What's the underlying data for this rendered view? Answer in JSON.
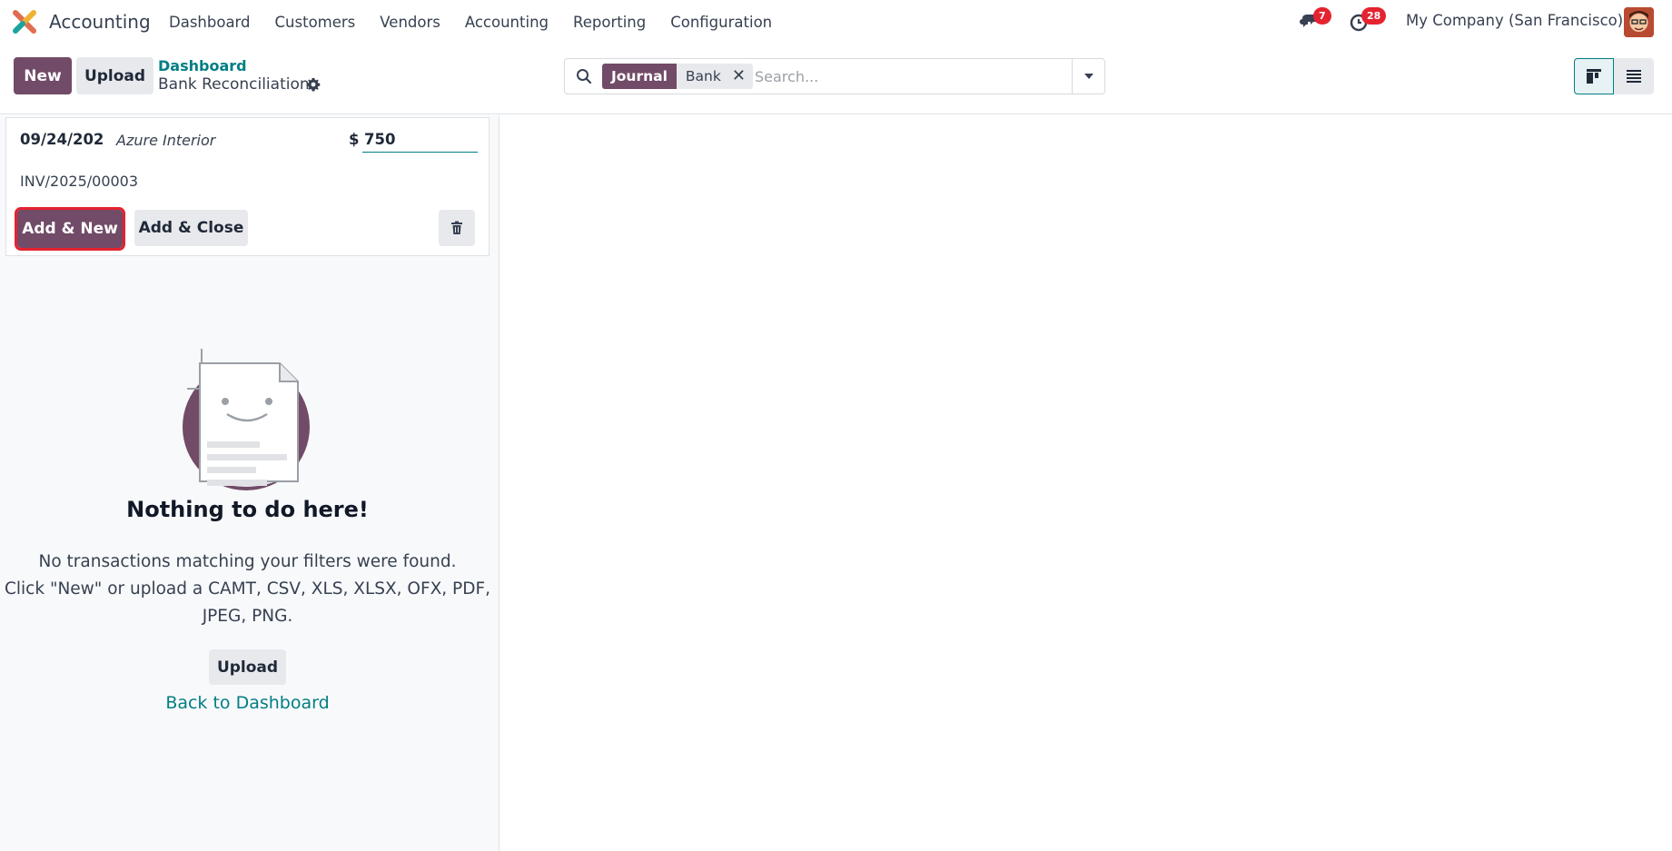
{
  "topbar": {
    "app_name": "Accounting",
    "menu": [
      "Dashboard",
      "Customers",
      "Vendors",
      "Accounting",
      "Reporting",
      "Configuration"
    ],
    "messages_badge": "7",
    "activities_badge": "28",
    "company": "My Company (San Francisco)"
  },
  "controls": {
    "new_label": "New",
    "upload_label": "Upload",
    "breadcrumb_parent": "Dashboard",
    "breadcrumb_current": "Bank Reconciliation"
  },
  "search": {
    "facet_label": "Journal",
    "facet_value": "Bank",
    "placeholder": "Search..."
  },
  "card": {
    "date": "09/24/202",
    "partner": "Azure Interior",
    "currency": "$",
    "amount": "750",
    "reference": "INV/2025/00003",
    "add_new_label": "Add & New",
    "add_close_label": "Add & Close"
  },
  "empty": {
    "title": "Nothing to do here!",
    "line1": "No transactions matching your filters were found.",
    "line2": "Click \"New\" or upload a CAMT, CSV, XLS, XLSX, OFX, PDF,",
    "line3": "JPEG, PNG.",
    "upload_label": "Upload",
    "back_label": "Back to Dashboard"
  },
  "colors": {
    "primary": "#714b67",
    "link": "#017e84",
    "badge": "#e4232f",
    "highlight": "#e4232f"
  }
}
